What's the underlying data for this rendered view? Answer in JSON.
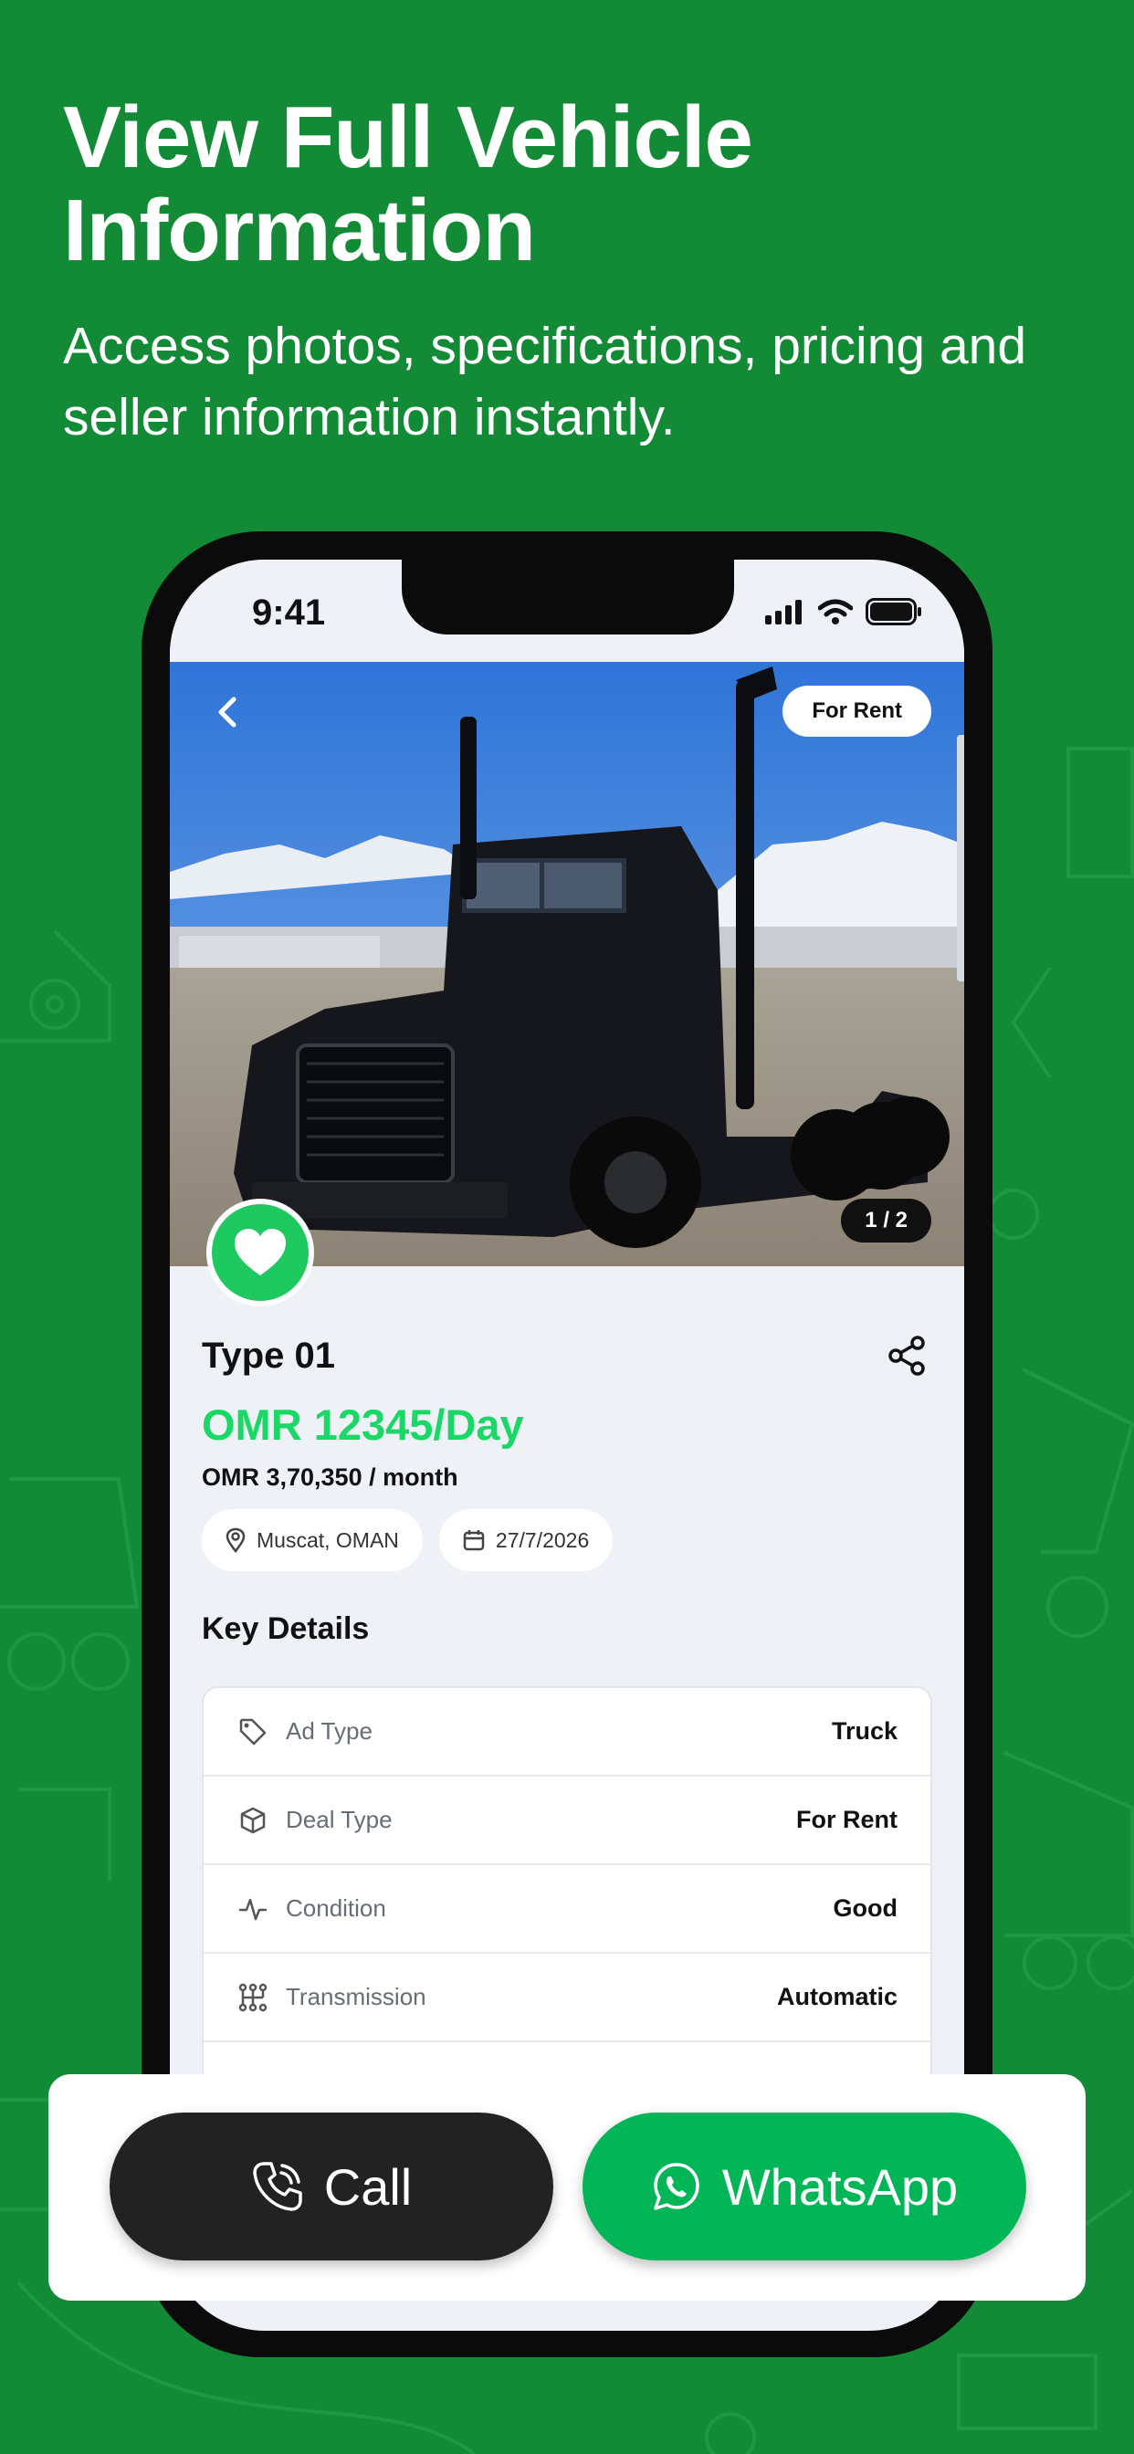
{
  "marketing": {
    "headline": "View Full Vehicle Information",
    "subline": "Access photos, specifications, pricing and seller information instantly."
  },
  "status_bar": {
    "time": "9:41"
  },
  "hero": {
    "badge": "For Rent",
    "image_counter": "1 / 2"
  },
  "listing": {
    "title": "Type 01",
    "price": "OMR 12345/Day",
    "monthly_price": "OMR 3,70,350 / month",
    "location": "Muscat, OMAN",
    "date": "27/7/2026"
  },
  "key_details": {
    "heading": "Key Details",
    "rows": [
      {
        "label": "Ad Type",
        "value": "Truck",
        "icon": "tag-icon"
      },
      {
        "label": "Deal Type",
        "value": "For Rent",
        "icon": "box-icon"
      },
      {
        "label": "Condition",
        "value": "Good",
        "icon": "pulse-icon"
      },
      {
        "label": "Transmission",
        "value": "Automatic",
        "icon": "gearbox-icon"
      }
    ]
  },
  "actions": {
    "call_label": "Call",
    "whatsapp_label": "WhatsApp"
  },
  "colors": {
    "background": "#138a36",
    "accent_green": "#1bd866",
    "whatsapp_green": "#02b657",
    "dark_button": "#222222"
  }
}
